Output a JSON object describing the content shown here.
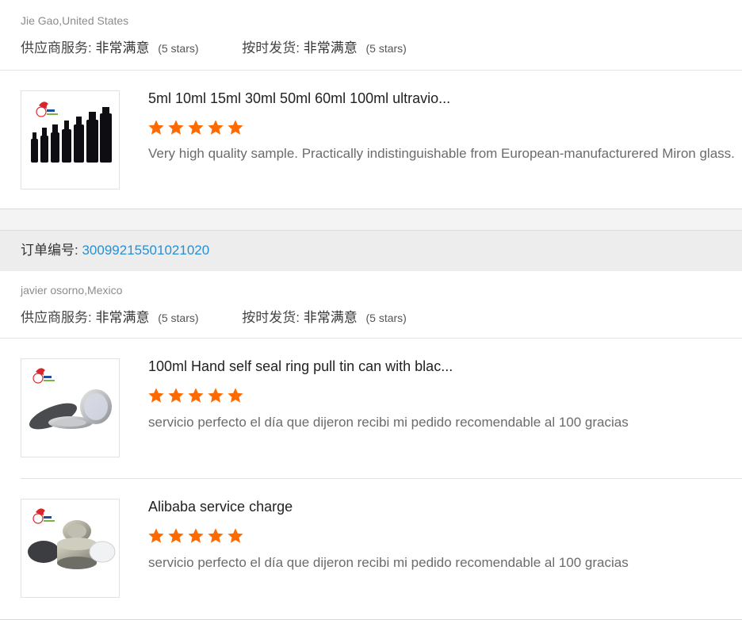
{
  "review1": {
    "buyer": "Jie Gao,United States",
    "supplier_service_label": "供应商服务:",
    "supplier_service_value": "非常满意",
    "supplier_service_stars": "(5 stars)",
    "on_time_label": "按时发货:",
    "on_time_value": "非常满意",
    "on_time_stars": "(5 stars)",
    "items": [
      {
        "title": "5ml 10ml 15ml 30ml 50ml 60ml 100ml ultravio...",
        "rating": 5,
        "comment": "Very high quality sample. Practically indistinguishable from European-manufacturered Miron glass."
      }
    ]
  },
  "order2": {
    "label": "订单编号:",
    "number": "30099215501021020"
  },
  "review2": {
    "buyer": "javier osorno,Mexico",
    "supplier_service_label": "供应商服务:",
    "supplier_service_value": "非常满意",
    "supplier_service_stars": "(5 stars)",
    "on_time_label": "按时发货:",
    "on_time_value": "非常满意",
    "on_time_stars": "(5 stars)",
    "items": [
      {
        "title": "100ml Hand self seal ring pull tin can with blac...",
        "rating": 5,
        "comment": "servicio perfecto  el día que dijeron recibi mi pedido recomendable al 100 gracias"
      },
      {
        "title": "Alibaba service charge",
        "rating": 5,
        "comment": "servicio perfecto  el día que dijeron recibi mi pedido recomendable al 100 gracias"
      }
    ]
  },
  "colors": {
    "star": "#ff6a00",
    "order_number": "#2a8fd0",
    "logo_red": "#d9262c"
  },
  "icons": {
    "star": "star-icon",
    "product_image": "product-thumbnail"
  }
}
